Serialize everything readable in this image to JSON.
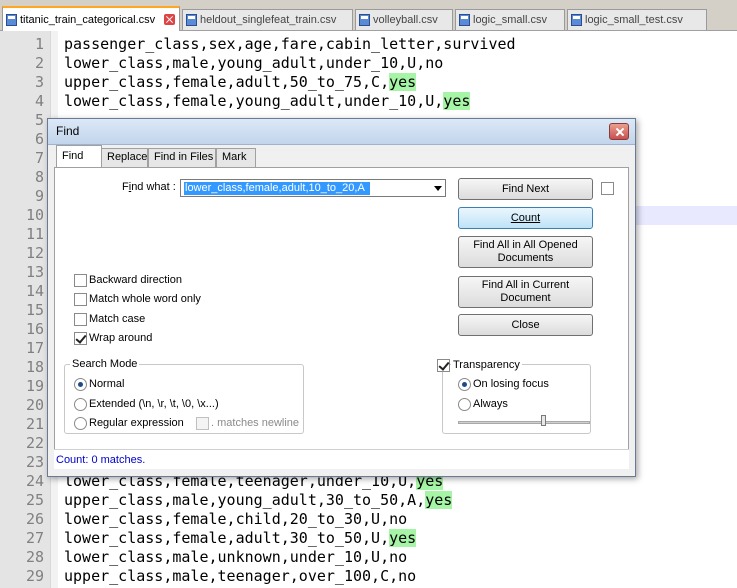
{
  "tabs": [
    {
      "label": "titanic_train_categorical.csv",
      "active": true
    },
    {
      "label": "heldout_singlefeat_train.csv",
      "active": false
    },
    {
      "label": "volleyball.csv",
      "active": false
    },
    {
      "label": "logic_small.csv",
      "active": false
    },
    {
      "label": "logic_small_test.csv",
      "active": false
    }
  ],
  "editor": {
    "lines": [
      {
        "n": "1",
        "text": "passenger_class,sex,age,fare,cabin_letter,survived",
        "hl": ""
      },
      {
        "n": "2",
        "text": "lower_class,male,young_adult,under_10,U,no",
        "hl": ""
      },
      {
        "n": "3",
        "text": "upper_class,female,adult,50_to_75,C,",
        "hl": "yes"
      },
      {
        "n": "4",
        "text": "lower_class,female,young_adult,under_10,U,",
        "hl": "yes"
      },
      {
        "n": "5",
        "text": "",
        "hl": ""
      },
      {
        "n": "6",
        "text": "",
        "hl": ""
      },
      {
        "n": "7",
        "text": "",
        "hl": ""
      },
      {
        "n": "8",
        "text": "",
        "hl": ""
      },
      {
        "n": "9",
        "text": "",
        "hl": ""
      },
      {
        "n": "10",
        "text": "",
        "hl": ""
      },
      {
        "n": "11",
        "text": "",
        "hl": ""
      },
      {
        "n": "12",
        "text": "",
        "hl": ""
      },
      {
        "n": "13",
        "text": "",
        "hl": ""
      },
      {
        "n": "14",
        "text": "",
        "hl": ""
      },
      {
        "n": "15",
        "text": "",
        "hl": ""
      },
      {
        "n": "16",
        "text": "",
        "hl": ""
      },
      {
        "n": "17",
        "text": "",
        "hl": ""
      },
      {
        "n": "18",
        "text": "",
        "hl": ""
      },
      {
        "n": "19",
        "text": "",
        "hl": ""
      },
      {
        "n": "20",
        "text": "",
        "hl": ""
      },
      {
        "n": "21",
        "text": "",
        "hl": ""
      },
      {
        "n": "22",
        "text": "",
        "hl": ""
      },
      {
        "n": "23",
        "text": "",
        "hl": ""
      },
      {
        "n": "24",
        "text": "lower_class,female,teenager,under_10,U,",
        "hl": "yes"
      },
      {
        "n": "25",
        "text": "upper_class,male,young_adult,30_to_50,A,",
        "hl": "yes"
      },
      {
        "n": "26",
        "text": "lower_class,female,child,20_to_30,U,no",
        "hl": ""
      },
      {
        "n": "27",
        "text": "lower_class,female,adult,30_to_50,U,",
        "hl": "yes"
      },
      {
        "n": "28",
        "text": "lower_class,male,unknown,under_10,U,no",
        "hl": ""
      },
      {
        "n": "29",
        "text": "upper_class,male,teenager,over_100,C,no",
        "hl": ""
      }
    ]
  },
  "dialog": {
    "title": "Find",
    "tabs": [
      "Find",
      "Replace",
      "Find in Files",
      "Mark"
    ],
    "find_what": {
      "label_pre": "F",
      "label_u": "i",
      "label_post": "nd what :",
      "value": "lower_class,female,adult,10_to_20,A"
    },
    "buttons": {
      "find_next": "Find Next",
      "count": "Count",
      "find_all_opened_1": "Find All in All Opened",
      "find_all_opened_2": "Documents",
      "find_all_current_1": "Find All in Current",
      "find_all_current_2": "Document",
      "close": "Close"
    },
    "options": {
      "backward": "Backward direction",
      "whole_word": "Match whole word only",
      "match_case": "Match case",
      "wrap_around": "Wrap around"
    },
    "search_mode": {
      "title": "Search Mode",
      "normal": "Normal",
      "extended": "Extended (\\n, \\r, \\t, \\0, \\x...)",
      "regex": "Regular expression",
      "matches_newline": ". matches newline"
    },
    "transparency": {
      "title": "Transparency",
      "on_losing_focus": "On losing focus",
      "always": "Always",
      "level": 0.65
    },
    "status": "Count: 0 matches."
  }
}
